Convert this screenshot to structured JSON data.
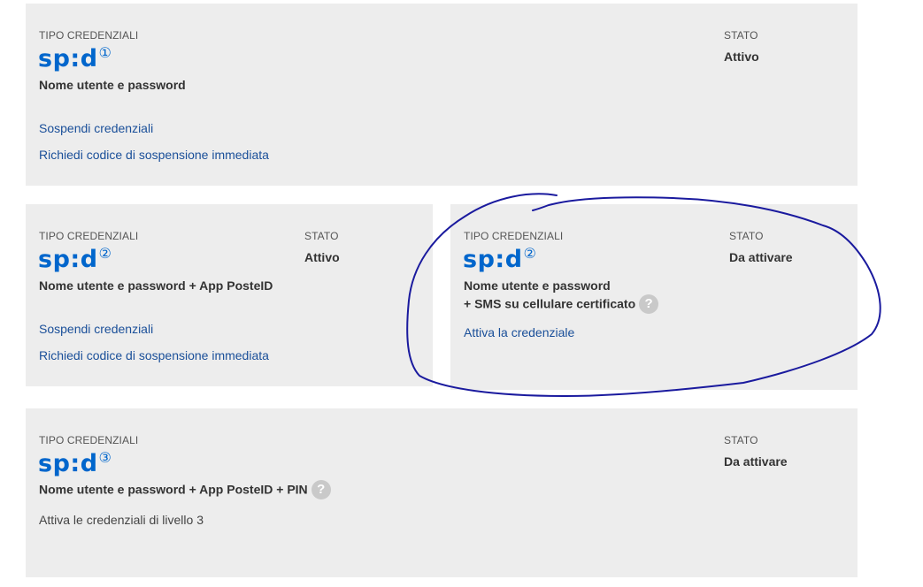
{
  "colors": {
    "card_bg": "#ededed",
    "spid_blue": "#0066cc",
    "link": "#1a4f99",
    "annotation": "#1a1a9e"
  },
  "cards": [
    {
      "type_label": "TIPO CREDENZIALI",
      "logo": "sp:d",
      "level_glyph": "①",
      "description": "Nome utente e password",
      "status_label": "STATO",
      "status_value": "Attivo",
      "links": [
        "Sospendi credenziali",
        "Richiedi codice di sospensione immediata"
      ]
    },
    {
      "type_label": "TIPO CREDENZIALI",
      "logo": "sp:d",
      "level_glyph": "②",
      "description": "Nome utente e password + App PosteID",
      "status_label": "STATO",
      "status_value": "Attivo",
      "links": [
        "Sospendi credenziali",
        "Richiedi codice di sospensione immediata"
      ]
    },
    {
      "type_label": "TIPO CREDENZIALI",
      "logo": "sp:d",
      "level_glyph": "②",
      "description_line1": "Nome utente e password",
      "description_line2": "+ SMS su cellulare certificato",
      "help": "?",
      "status_label": "STATO",
      "status_value": "Da attivare",
      "links": [
        "Attiva la credenziale"
      ]
    },
    {
      "type_label": "TIPO CREDENZIALI",
      "logo": "sp:d",
      "level_glyph": "③",
      "description": "Nome utente e password + App PosteID + PIN",
      "help": "?",
      "status_label": "STATO",
      "status_value": "Da attivare",
      "note": "Attiva le credenziali di livello 3"
    }
  ]
}
